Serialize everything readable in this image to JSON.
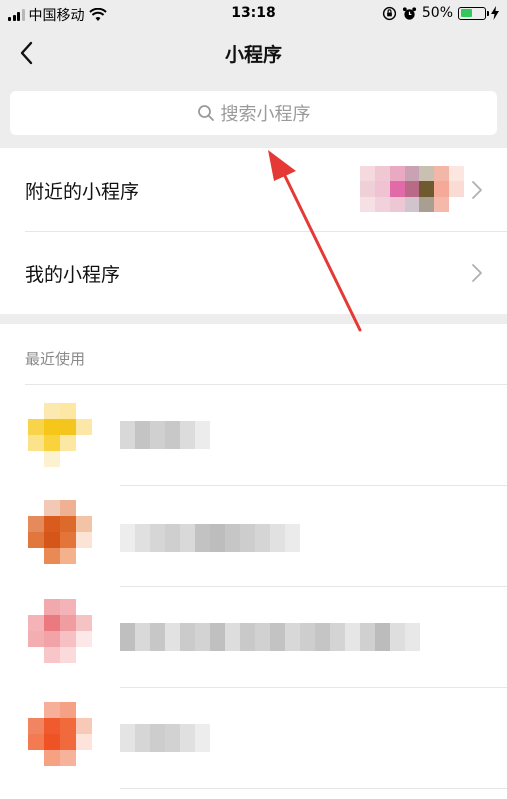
{
  "status_bar": {
    "carrier": "中国移动",
    "time": "13:18",
    "battery_percent": "50%",
    "battery_level": 0.5,
    "icons": [
      "signal-icon",
      "wifi-icon",
      "orientation-lock-icon",
      "alarm-icon",
      "battery-icon",
      "charging-icon"
    ]
  },
  "navbar": {
    "title": "小程序",
    "back_icon": "chevron-left-icon"
  },
  "search": {
    "placeholder": "搜索小程序",
    "icon": "search-icon"
  },
  "menu": [
    {
      "label": "附近的小程序",
      "icon": "chevron-right-icon"
    },
    {
      "label": "我的小程序",
      "icon": "chevron-right-icon"
    }
  ],
  "recent": {
    "title": "最近使用",
    "note": "app icons and names are pixelated/censored in the screenshot"
  },
  "colors": {
    "background_gray": "#ededed",
    "annotation_arrow": "#e53935",
    "battery_green": "#34c759"
  }
}
